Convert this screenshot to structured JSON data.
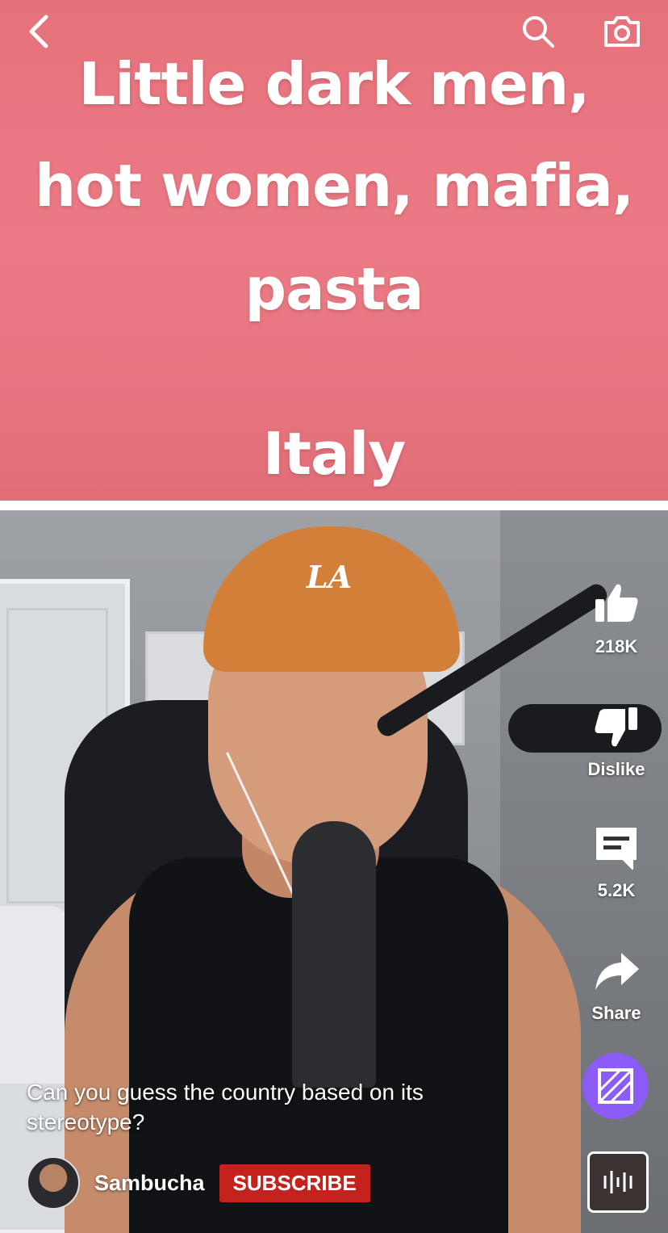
{
  "top_bar": {
    "back_icon": "chevron-left-icon",
    "search_icon": "search-icon",
    "camera_icon": "camera-icon"
  },
  "title_card": {
    "line1": "Little dark men,",
    "line2": "hot women, mafia,",
    "line3": "pasta",
    "answer": "Italy",
    "background_color": "#ec7a84"
  },
  "actions": {
    "like_count": "218K",
    "dislike_label": "Dislike",
    "comment_count": "5.2K",
    "share_label": "Share"
  },
  "video": {
    "caption": "Can you guess the country based on its stereotype?",
    "channel_name": "Sambucha",
    "subscribe_label": "SUBSCRIBE"
  },
  "colors": {
    "subscribe_red": "#c4221c",
    "remix_purple": "#8b5cf6"
  }
}
